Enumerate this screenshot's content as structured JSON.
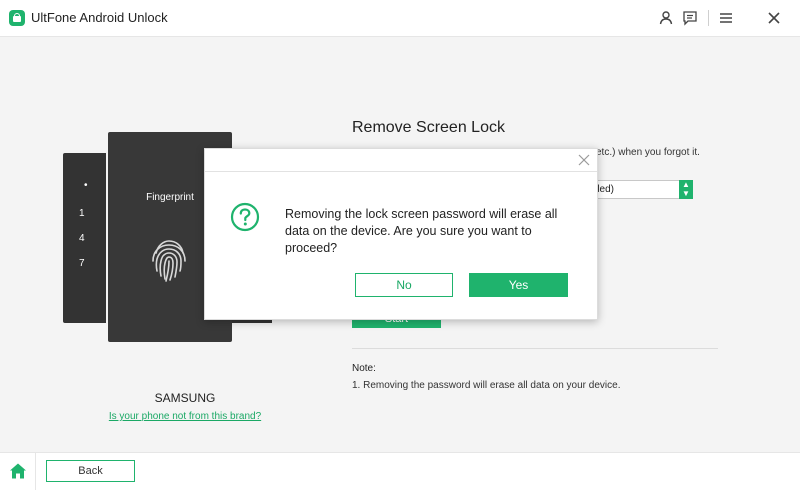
{
  "app": {
    "title": "UltFone Android Unlock"
  },
  "titlebar": {
    "icons": [
      "user-icon",
      "feedback-icon",
      "menu-icon",
      "close-icon"
    ]
  },
  "illustration": {
    "back_phone_dots": "• •",
    "back_phone_numbers": [
      "1",
      "4",
      "7"
    ],
    "front_phone_label": "Fingerprint",
    "brand": "SAMSUNG",
    "brand_link": "Is your phone not from this brand?"
  },
  "section": {
    "title": "Remove Screen Lock",
    "description_visible": "etc.) when you forgot it.",
    "select_value_visible": "ded)",
    "start_label": "Start"
  },
  "note": {
    "title": "Note:",
    "items": [
      "1. Removing the password will erase all data on your device."
    ]
  },
  "dialog": {
    "message": "Removing the lock screen password will erase all data on the device. Are you sure you want to proceed?",
    "no_label": "No",
    "yes_label": "Yes"
  },
  "bottom": {
    "back_label": "Back"
  },
  "colors": {
    "accent": "#1fb36d",
    "phone": "#383838",
    "background": "#f4f4f4"
  }
}
